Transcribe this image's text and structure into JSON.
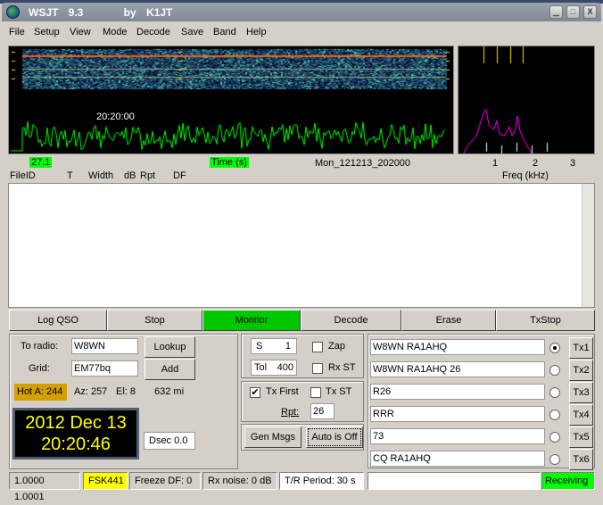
{
  "window": {
    "title": "WSJT 9.3    by K1JT",
    "minimize": "▁",
    "maximize": "□",
    "close": "X"
  },
  "menu": [
    "File",
    "Setup",
    "View",
    "Mode",
    "Decode",
    "Save",
    "Band",
    "Help"
  ],
  "display": {
    "waterfall_time": "20:20:00",
    "level": "27.1",
    "time_axis_label": "Time (s)",
    "file_label": "Mon_121213_202000",
    "freq_ticks": [
      "1",
      "2",
      "3"
    ],
    "freq_label": "Freq (kHz)",
    "waveform_color": "#00ff00",
    "spectrum_color": "#ff00ff"
  },
  "decode_headers": [
    "FileID",
    "T",
    "Width",
    "dB",
    "Rpt",
    "DF"
  ],
  "actions": [
    "Log QSO",
    "Stop",
    "Monitor",
    "Decode",
    "Erase",
    "TxStop"
  ],
  "active_action": "Monitor",
  "qso": {
    "to_radio_label": "To radio:",
    "to_radio": "W8WN",
    "grid_label": "Grid:",
    "grid": "EM77bq",
    "lookup": "Lookup",
    "add": "Add",
    "hot": "Hot A: 244",
    "az": "Az: 257",
    "el": "El: 8",
    "dist": "632 mi",
    "date": "2012 Dec 13",
    "time": "20:20:46",
    "dsec": "Dsec  0.0"
  },
  "settings": {
    "s_label": "S",
    "s_value": "1",
    "tol_label": "Tol",
    "tol_value": "400",
    "zap": "Zap",
    "zap_checked": false,
    "rxst": "Rx ST",
    "rxst_checked": false,
    "txfirst": "Tx First",
    "txfirst_checked": true,
    "txst": "Tx ST",
    "txst_checked": false,
    "rpt_label": "Rpt:",
    "rpt": "26",
    "gen_msgs": "Gen Msgs",
    "auto": "Auto is Off"
  },
  "tx_messages": [
    {
      "text": "W8WN RA1AHQ",
      "selected": true,
      "button": "Tx1"
    },
    {
      "text": "W8WN RA1AHQ 26",
      "selected": false,
      "button": "Tx2"
    },
    {
      "text": "R26",
      "selected": false,
      "button": "Tx3"
    },
    {
      "text": "RRR",
      "selected": false,
      "button": "Tx4"
    },
    {
      "text": "73",
      "selected": false,
      "button": "Tx5"
    },
    {
      "text": "CQ RA1AHQ",
      "selected": false,
      "button": "Tx6"
    }
  ],
  "status": {
    "ratio": "1.0000 1.0001",
    "mode": "FSK441",
    "freeze": "Freeze DF:   0",
    "rx_noise": "Rx noise:  0 dB",
    "tr_period": "T/R Period: 30 s",
    "state": "Receiving"
  }
}
